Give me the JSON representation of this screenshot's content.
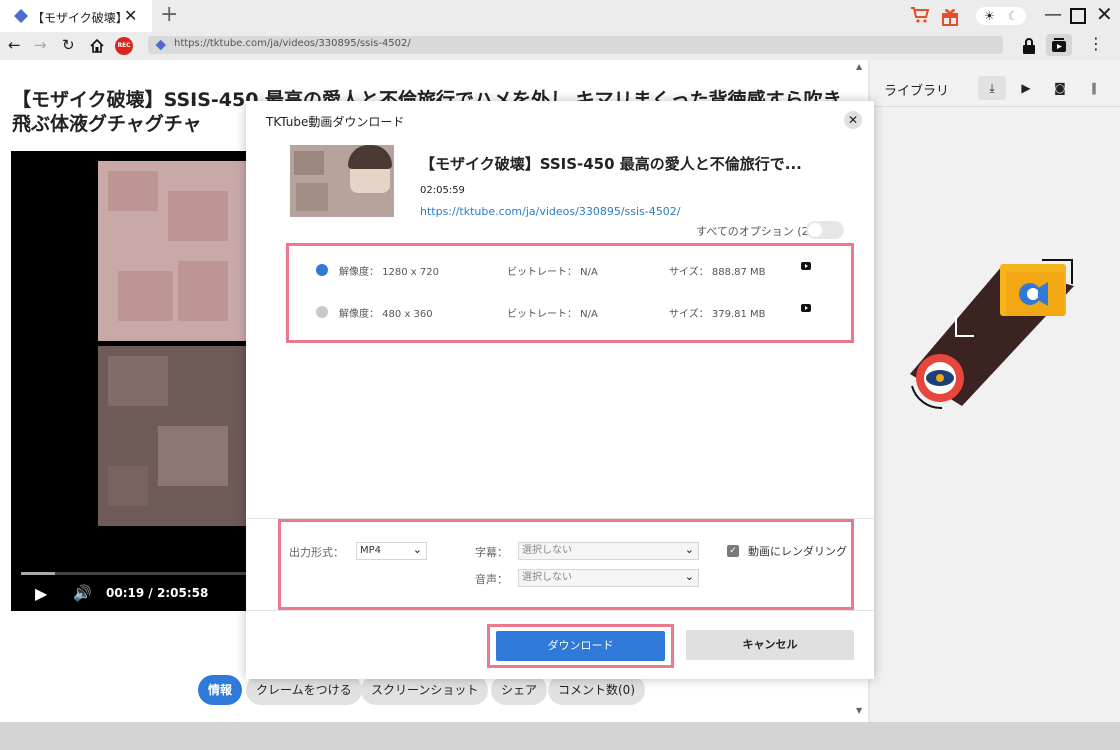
{
  "tab": {
    "title": "【モザイク破壊】SSIS-450",
    "new_tab": "+"
  },
  "navbar": {
    "url": "https://tktube.com/ja/videos/330895/ssis-4502/",
    "rec": "REC"
  },
  "page": {
    "title": "【モザイク破壊】SSIS-450 最高の愛人と不倫旅行でハメを外し キマリまくった背徳感すら吹き飛ぶ体液グチャグチャ",
    "player": {
      "current_time": "00:19",
      "separator": "/",
      "total_time": "2:05:58",
      "progress": 0.15
    },
    "tabs": [
      "情報",
      "クレームをつける",
      "スクリーンショット",
      "シェア",
      "コメント数(0)"
    ]
  },
  "right_pane": {
    "title": "ライブラリ"
  },
  "dialog": {
    "title": "TKTube動画ダウンロード",
    "video_title": "【モザイク破壊】SSIS-450 最高の愛人と不倫旅行で...",
    "duration": "02:05:59",
    "url": "https://tktube.com/ja/videos/330895/ssis-4502/",
    "all_options_label": "すべてのオプション",
    "all_options_count": "(2)",
    "options": [
      {
        "resolution": "解像度： 1280 x 720",
        "bitrate": "ビットレート： N/A",
        "size": "サイズ： 888.87 MB",
        "selected": true
      },
      {
        "resolution": "解像度： 480 x 360",
        "bitrate": "ビットレート： N/A",
        "size": "サイズ： 379.81 MB",
        "selected": false
      }
    ],
    "settings": {
      "format_label": "出力形式：",
      "format_value": "MP4",
      "subtitle_label": "字幕：",
      "subtitle_value": "選択しない",
      "audio_label": "音声：",
      "audio_value": "選択しない",
      "render_label": "動画にレンダリング",
      "render_checked": true
    },
    "download_button": "ダウンロード",
    "cancel_button": "キャンセル"
  },
  "colors": {
    "accent": "#2f7ad8",
    "highlight": "#e97a8d",
    "rec": "#d9251d"
  }
}
